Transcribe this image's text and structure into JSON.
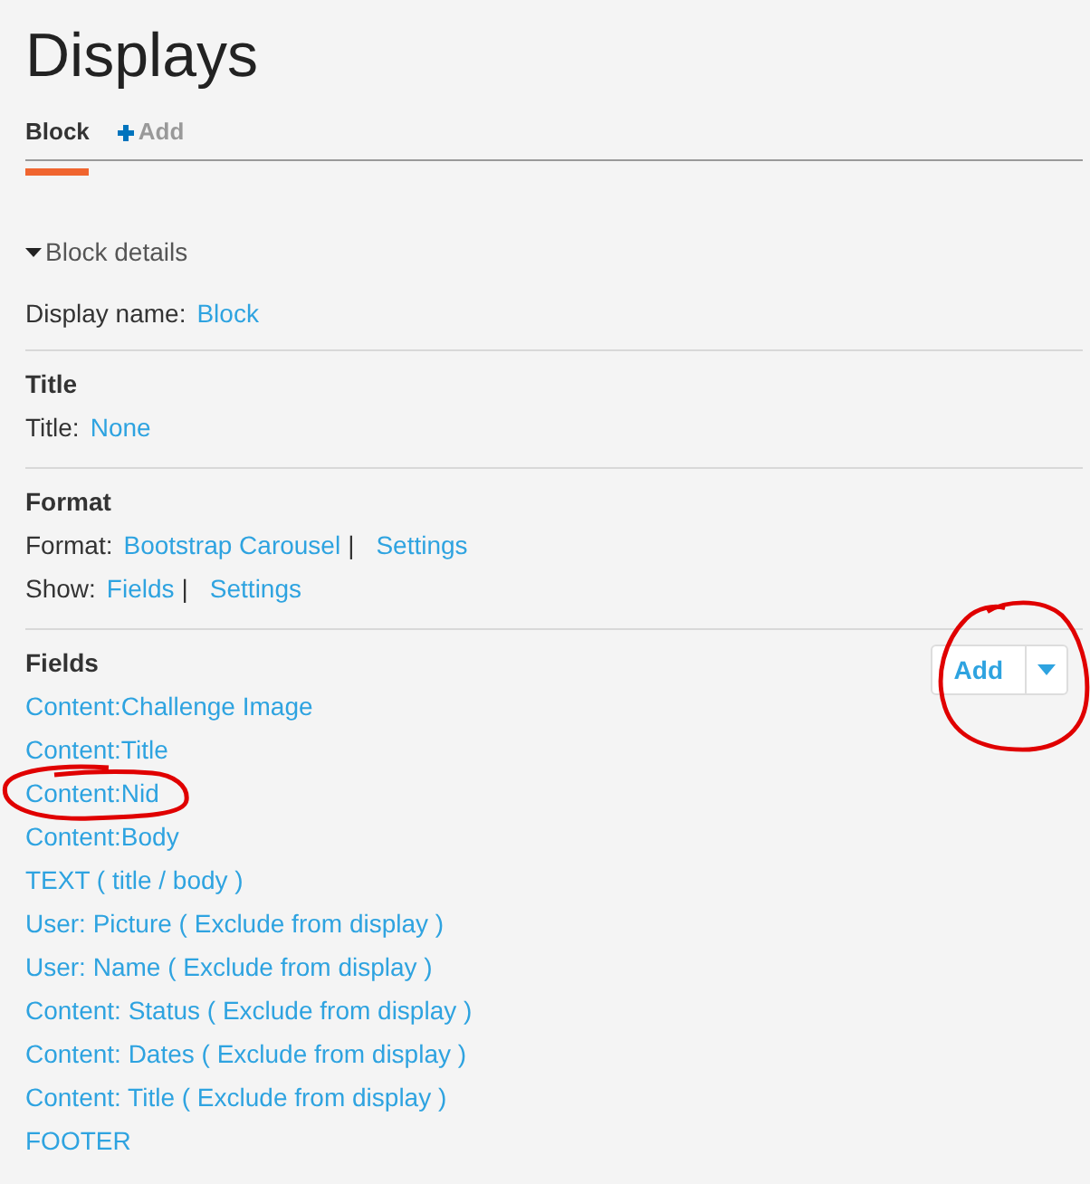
{
  "page_title": "Displays",
  "tabs": [
    {
      "kind": "display",
      "label": "Block",
      "selected": true
    },
    {
      "kind": "add",
      "label": "Add",
      "selected": false
    }
  ],
  "details": {
    "summary": "Block details",
    "expanded": true
  },
  "display_name": {
    "label": "Display name:",
    "value": "Block"
  },
  "sections": [
    {
      "heading": "Title",
      "settings": [
        {
          "label": "Title:",
          "value": "None"
        }
      ]
    },
    {
      "heading": "Format",
      "settings": [
        {
          "label": "Format:",
          "value": "Bootstrap Carousel",
          "separator": "|",
          "extra_link": "Settings"
        },
        {
          "label": "Show:",
          "value": "Fields",
          "separator": "|",
          "extra_link": "Settings"
        }
      ]
    },
    {
      "heading": "Fields",
      "add_button": {
        "label": "Add",
        "circled": true
      },
      "items": [
        {
          "text": "Content:Challenge Image",
          "circled": false
        },
        {
          "text": "Content:Title",
          "circled": false
        },
        {
          "text": "Content:Nid",
          "circled": true
        },
        {
          "text": "Content:Body",
          "circled": false
        },
        {
          "text": "TEXT ( title / body )",
          "circled": false
        },
        {
          "text": "User: Picture ( Exclude from display )",
          "circled": false
        },
        {
          "text": "User: Name ( Exclude from display )",
          "circled": false
        },
        {
          "text": "Content: Status ( Exclude from display )",
          "circled": false
        },
        {
          "text": "Content: Dates ( Exclude from display )",
          "circled": false
        },
        {
          "text": "Content: Title ( Exclude from display )",
          "circled": false
        },
        {
          "text": "FOOTER",
          "circled": false
        }
      ]
    }
  ]
}
